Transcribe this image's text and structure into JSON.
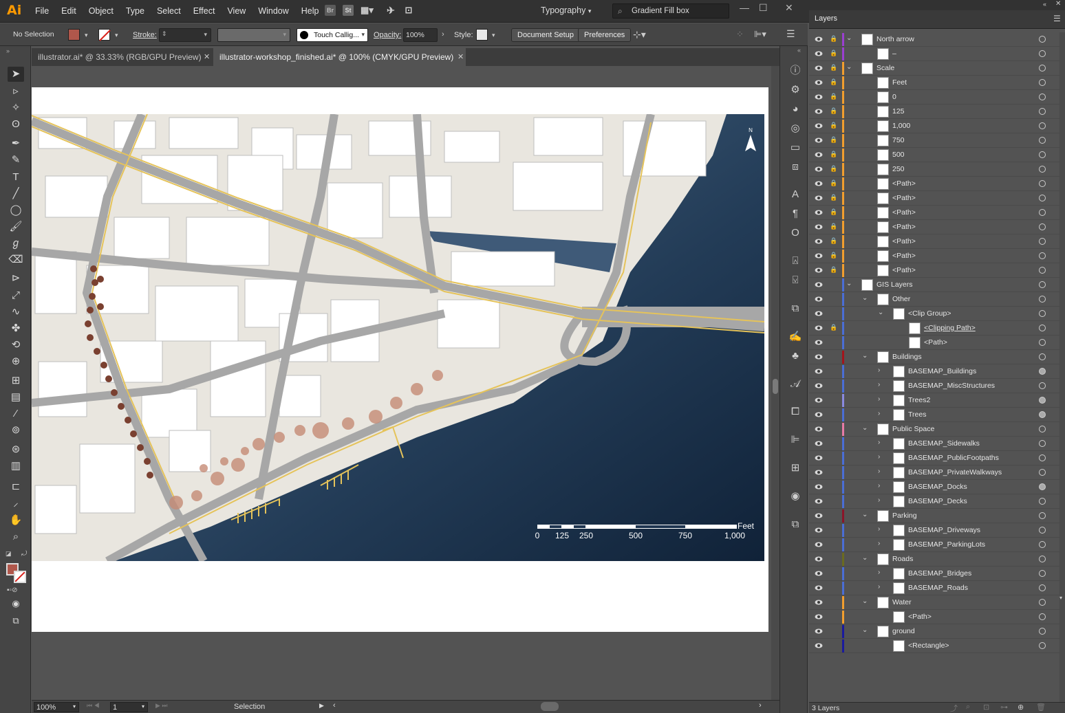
{
  "menubar": {
    "logo": "Ai",
    "items": [
      "File",
      "Edit",
      "Object",
      "Type",
      "Select",
      "Effect",
      "View",
      "Window",
      "Help"
    ],
    "bridge_icon": "Br",
    "stock_icon": "St",
    "workspace": "Typography",
    "search_value": "Gradient Fill box"
  },
  "control": {
    "selection": "No Selection",
    "stroke_label": "Stroke:",
    "brush": "Touch Callig...",
    "opacity_label": "Opacity:",
    "opacity": "100%",
    "style_label": "Style:",
    "doc_setup": "Document Setup",
    "preferences": "Preferences",
    "fill_color": "#b0574b"
  },
  "tabs": [
    {
      "label": "illustrator.ai* @ 33.33% (RGB/GPU Preview)"
    },
    {
      "label": "illustrator-workshop_finished.ai* @ 100% (CMYK/GPU Preview)"
    }
  ],
  "map": {
    "north": "N",
    "scale_unit": "Feet",
    "scale_ticks": [
      "0",
      "125",
      "250",
      "500",
      "750",
      "1,000"
    ]
  },
  "statusbar": {
    "zoom": "100%",
    "page": "1",
    "mode": "Selection"
  },
  "layers": {
    "title": "Layers",
    "footer": "3 Layers",
    "rows": [
      {
        "name": "North arrow",
        "level": 0,
        "expand": "open",
        "lock": true,
        "color": "#9b3fd1",
        "circle": "o"
      },
      {
        "name": "–",
        "level": 1,
        "expand": "",
        "lock": true,
        "color": "#9b3fd1",
        "circle": "o"
      },
      {
        "name": "Scale",
        "level": 0,
        "expand": "open",
        "lock": true,
        "color": "#f29e2e",
        "circle": "o"
      },
      {
        "name": "Feet",
        "level": 1,
        "expand": "",
        "lock": true,
        "color": "#f29e2e",
        "circle": "o"
      },
      {
        "name": "0",
        "level": 1,
        "expand": "",
        "lock": true,
        "color": "#f29e2e",
        "circle": "o"
      },
      {
        "name": "125",
        "level": 1,
        "expand": "",
        "lock": true,
        "color": "#f29e2e",
        "circle": "o"
      },
      {
        "name": "1,000",
        "level": 1,
        "expand": "",
        "lock": true,
        "color": "#f29e2e",
        "circle": "o"
      },
      {
        "name": "750",
        "level": 1,
        "expand": "",
        "lock": true,
        "color": "#f29e2e",
        "circle": "o"
      },
      {
        "name": "500",
        "level": 1,
        "expand": "",
        "lock": true,
        "color": "#f29e2e",
        "circle": "o"
      },
      {
        "name": "250",
        "level": 1,
        "expand": "",
        "lock": true,
        "color": "#f29e2e",
        "circle": "o"
      },
      {
        "name": "<Path>",
        "level": 1,
        "expand": "",
        "lock": true,
        "color": "#f29e2e",
        "circle": "o"
      },
      {
        "name": "<Path>",
        "level": 1,
        "expand": "",
        "lock": true,
        "color": "#f29e2e",
        "circle": "o"
      },
      {
        "name": "<Path>",
        "level": 1,
        "expand": "",
        "lock": true,
        "color": "#f29e2e",
        "circle": "o"
      },
      {
        "name": "<Path>",
        "level": 1,
        "expand": "",
        "lock": true,
        "color": "#f29e2e",
        "circle": "o"
      },
      {
        "name": "<Path>",
        "level": 1,
        "expand": "",
        "lock": true,
        "color": "#f29e2e",
        "circle": "o"
      },
      {
        "name": "<Path>",
        "level": 1,
        "expand": "",
        "lock": true,
        "color": "#f29e2e",
        "circle": "o"
      },
      {
        "name": "<Path>",
        "level": 1,
        "expand": "",
        "lock": true,
        "color": "#f29e2e",
        "circle": "o"
      },
      {
        "name": "GIS Layers",
        "level": 0,
        "expand": "open",
        "lock": false,
        "color": "#4a6ed6",
        "circle": "o"
      },
      {
        "name": "Other",
        "level": 1,
        "expand": "open",
        "lock": false,
        "color": "#4a6ed6",
        "circle": "o"
      },
      {
        "name": "<Clip Group>",
        "level": 2,
        "expand": "open",
        "lock": false,
        "color": "#4a6ed6",
        "circle": "o"
      },
      {
        "name": "<Clipping Path>",
        "level": 3,
        "expand": "",
        "lock": true,
        "color": "#4a6ed6",
        "circle": "o",
        "underline": true
      },
      {
        "name": "<Path>",
        "level": 3,
        "expand": "",
        "lock": false,
        "color": "#4a6ed6",
        "circle": "o"
      },
      {
        "name": "Buildings",
        "level": 1,
        "expand": "open",
        "lock": false,
        "color": "#a3141b",
        "circle": "o"
      },
      {
        "name": "BASEMAP_Buildings",
        "level": 2,
        "expand": "closed",
        "lock": false,
        "color": "#4a6ed6",
        "circle": "filled"
      },
      {
        "name": "BASEMAP_MiscStructures",
        "level": 2,
        "expand": "closed",
        "lock": false,
        "color": "#4a6ed6",
        "circle": "o"
      },
      {
        "name": "Trees2",
        "level": 2,
        "expand": "closed",
        "lock": false,
        "color": "#8a8ae0",
        "circle": "filled"
      },
      {
        "name": "Trees",
        "level": 2,
        "expand": "closed",
        "lock": false,
        "color": "#4a6ed6",
        "circle": "filled"
      },
      {
        "name": "Public Space",
        "level": 1,
        "expand": "open",
        "lock": false,
        "color": "#e87ba6",
        "circle": "o"
      },
      {
        "name": "BASEMAP_Sidewalks",
        "level": 2,
        "expand": "closed",
        "lock": false,
        "color": "#4a6ed6",
        "circle": "o"
      },
      {
        "name": "BASEMAP_PublicFootpaths",
        "level": 2,
        "expand": "closed",
        "lock": false,
        "color": "#4a6ed6",
        "circle": "o"
      },
      {
        "name": "BASEMAP_PrivateWalkways",
        "level": 2,
        "expand": "closed",
        "lock": false,
        "color": "#4a6ed6",
        "circle": "o"
      },
      {
        "name": "BASEMAP_Docks",
        "level": 2,
        "expand": "closed",
        "lock": false,
        "color": "#4a6ed6",
        "circle": "filled"
      },
      {
        "name": "BASEMAP_Decks",
        "level": 2,
        "expand": "closed",
        "lock": false,
        "color": "#4a6ed6",
        "circle": "o"
      },
      {
        "name": "Parking",
        "level": 1,
        "expand": "open",
        "lock": false,
        "color": "#8b1429",
        "circle": "o"
      },
      {
        "name": "BASEMAP_Driveways",
        "level": 2,
        "expand": "closed",
        "lock": false,
        "color": "#4a6ed6",
        "circle": "o"
      },
      {
        "name": "BASEMAP_ParkingLots",
        "level": 2,
        "expand": "closed",
        "lock": false,
        "color": "#4a6ed6",
        "circle": "o"
      },
      {
        "name": "Roads",
        "level": 1,
        "expand": "open",
        "lock": false,
        "color": "#6b6b20",
        "circle": "o"
      },
      {
        "name": "BASEMAP_Bridges",
        "level": 2,
        "expand": "closed",
        "lock": false,
        "color": "#4a6ed6",
        "circle": "o"
      },
      {
        "name": "BASEMAP_Roads",
        "level": 2,
        "expand": "closed",
        "lock": false,
        "color": "#4a6ed6",
        "circle": "o"
      },
      {
        "name": "Water",
        "level": 1,
        "expand": "open",
        "lock": false,
        "color": "#f29e2e",
        "circle": "o"
      },
      {
        "name": "<Path>",
        "level": 2,
        "expand": "",
        "lock": false,
        "color": "#f29e2e",
        "circle": "o"
      },
      {
        "name": "ground",
        "level": 1,
        "expand": "open",
        "lock": false,
        "color": "#1a1a9e",
        "circle": "o"
      },
      {
        "name": "<Rectangle>",
        "level": 2,
        "expand": "",
        "lock": false,
        "color": "#1a1a9e",
        "circle": "o"
      }
    ]
  }
}
